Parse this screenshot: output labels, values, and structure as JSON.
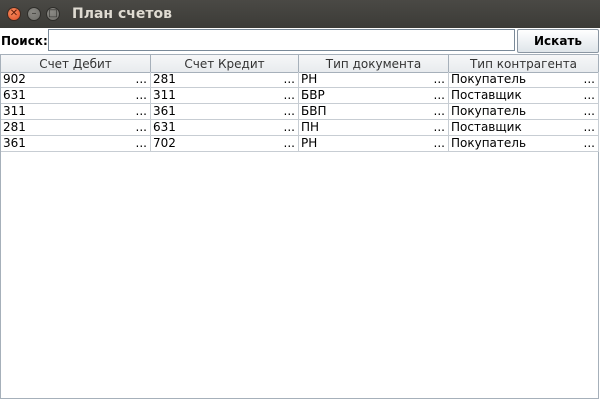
{
  "window": {
    "title": "План счетов"
  },
  "search": {
    "label": "Поиск:",
    "value": "",
    "button_label": "Искать"
  },
  "table": {
    "columns": [
      "Счет Дебит",
      "Счет Кредит",
      "Тип документа",
      "Тип контрагента"
    ],
    "ellipsis": "...",
    "rows": [
      [
        "902",
        "281",
        "РН",
        "Покупатель"
      ],
      [
        "631",
        "311",
        "БВР",
        "Поставщик"
      ],
      [
        "311",
        "361",
        "БВП",
        "Покупатель"
      ],
      [
        "281",
        "631",
        "ПН",
        "Поставщик"
      ],
      [
        "361",
        "702",
        "РН",
        "Покупатель"
      ]
    ]
  }
}
